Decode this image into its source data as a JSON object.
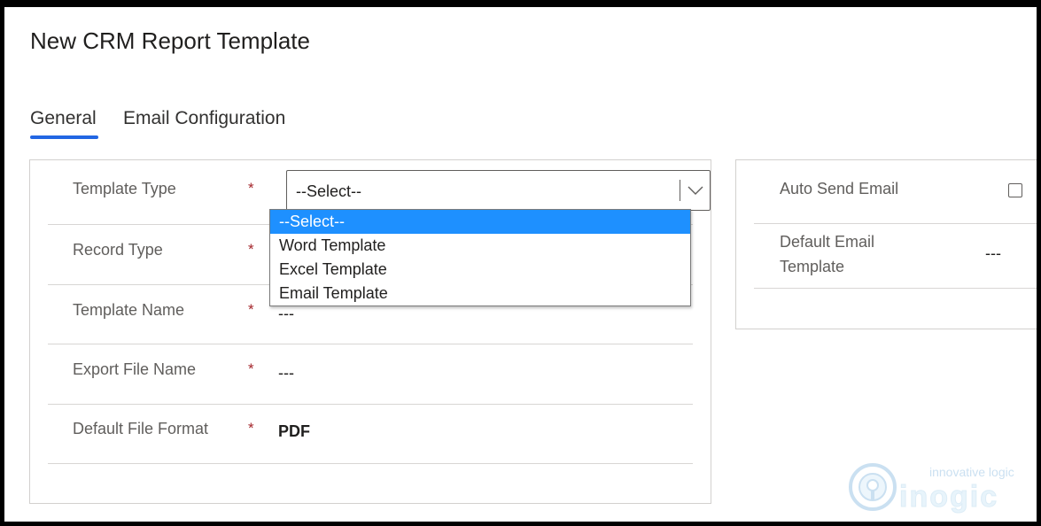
{
  "page": {
    "title": "New CRM Report Template"
  },
  "tabs": [
    {
      "label": "General",
      "active": true
    },
    {
      "label": "Email Configuration",
      "active": false
    }
  ],
  "general": {
    "required_marker": "*",
    "template_type": {
      "label": "Template Type",
      "value": "--Select--",
      "options": [
        "--Select--",
        "Word Template",
        "Excel Template",
        "Email Template"
      ],
      "highlighted_option": "--Select--"
    },
    "record_type": {
      "label": "Record Type",
      "value": "---"
    },
    "template_name": {
      "label": "Template Name",
      "value": "---"
    },
    "export_file_name": {
      "label": "Export File Name",
      "value": "---"
    },
    "default_file_format": {
      "label": "Default File Format",
      "value": "PDF"
    }
  },
  "email_side": {
    "auto_send_email": {
      "label": "Auto Send Email",
      "checked": false
    },
    "default_email_template": {
      "label_line1": "Default Email",
      "label_line2": "Template",
      "value": "---"
    }
  },
  "watermark": {
    "tagline": "innovative logic",
    "brand": "inogic"
  },
  "colors": {
    "accent": "#2266e3",
    "selected_option": "#1e90ff",
    "required": "#a4262c"
  }
}
